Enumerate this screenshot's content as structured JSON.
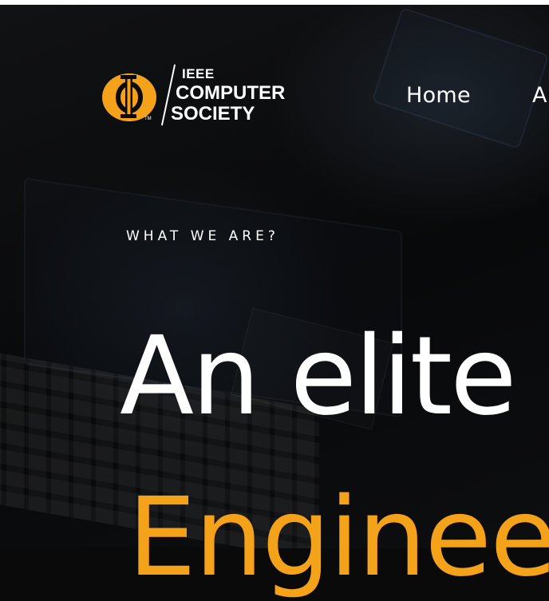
{
  "logo": {
    "line1": "IEEE",
    "line2": "COMPUTER",
    "line3": "SOCIETY",
    "trademark": "TM",
    "icon": "ieee-computer-society-logo-icon",
    "mark_color": "#f5a21b"
  },
  "nav": {
    "items": [
      {
        "label": "Home"
      },
      {
        "label": "Al"
      }
    ]
  },
  "hero": {
    "eyebrow": "WHAT WE ARE?",
    "headline": "An elite",
    "headline_accent": "Enginee",
    "accent_color": "#f5a21b"
  }
}
